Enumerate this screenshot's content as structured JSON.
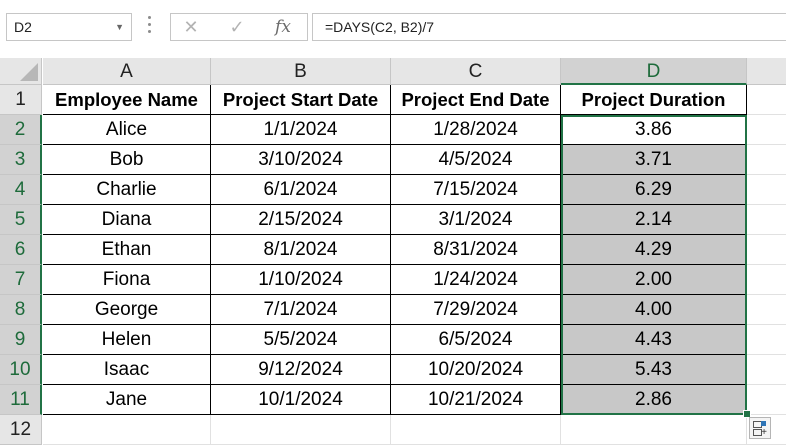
{
  "name_box": {
    "value": "D2"
  },
  "formula_bar": {
    "cancel_icon": "✕",
    "enter_icon": "✓",
    "fx_label": "fx",
    "formula": "=DAYS(C2, B2)/7"
  },
  "columns": [
    "A",
    "B",
    "C",
    "D"
  ],
  "rows": [
    "1",
    "2",
    "3",
    "4",
    "5",
    "6",
    "7",
    "8",
    "9",
    "10",
    "11",
    "12"
  ],
  "headers": [
    "Employee Name",
    "Project Start Date",
    "Project End Date",
    "Project Duration"
  ],
  "table": [
    [
      "Alice",
      "1/1/2024",
      "1/28/2024",
      "3.86"
    ],
    [
      "Bob",
      "3/10/2024",
      "4/5/2024",
      "3.71"
    ],
    [
      "Charlie",
      "6/1/2024",
      "7/15/2024",
      "6.29"
    ],
    [
      "Diana",
      "2/15/2024",
      "3/1/2024",
      "2.14"
    ],
    [
      "Ethan",
      "8/1/2024",
      "8/31/2024",
      "4.29"
    ],
    [
      "Fiona",
      "1/10/2024",
      "1/24/2024",
      "2.00"
    ],
    [
      "George",
      "7/1/2024",
      "7/29/2024",
      "4.00"
    ],
    [
      "Helen",
      "5/5/2024",
      "6/5/2024",
      "4.43"
    ],
    [
      "Isaac",
      "9/12/2024",
      "10/20/2024",
      "5.43"
    ],
    [
      "Jane",
      "10/1/2024",
      "10/21/2024",
      "2.86"
    ]
  ],
  "selection": {
    "range": "D2:D11",
    "active_cell": "D2"
  },
  "colors": {
    "accent": "#217346",
    "selected_fill": "#c8c8c8",
    "header_bg": "#e6e6e6"
  }
}
